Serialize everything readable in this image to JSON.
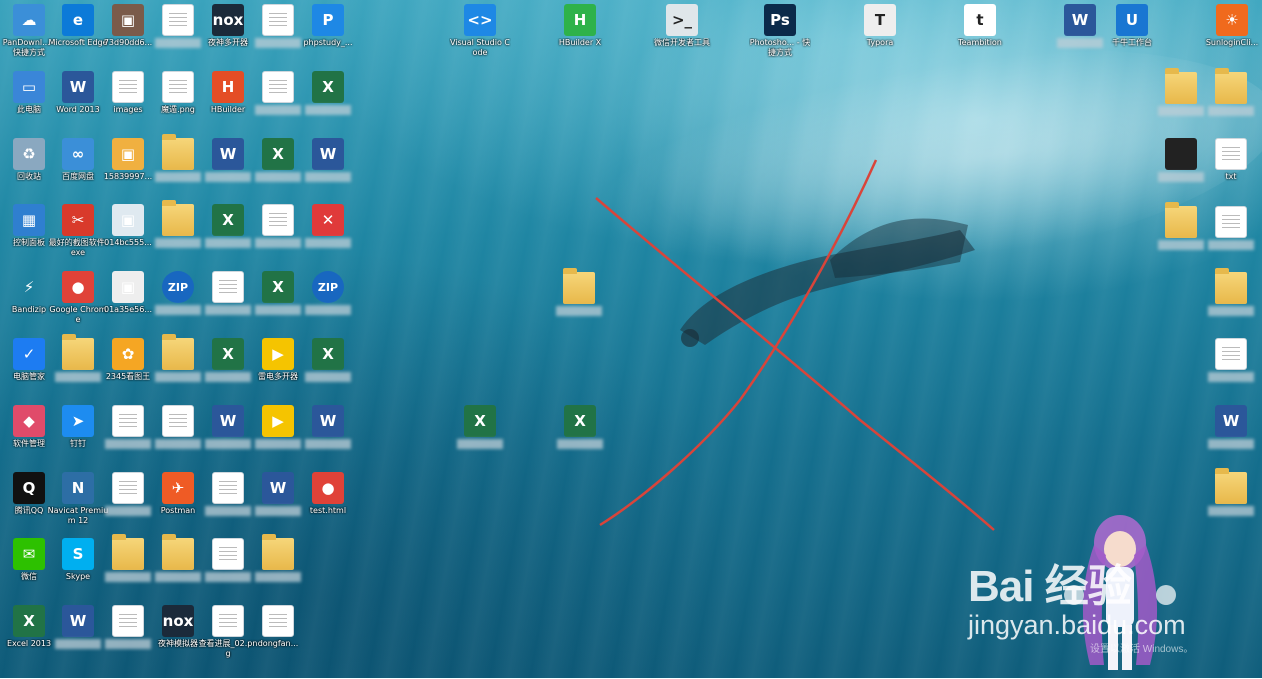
{
  "desktop": {
    "icons_col1": [
      {
        "label": "PanDownl... - 快捷方式",
        "icon": "cloud-icon",
        "color": "#3b8fd8"
      },
      {
        "label": "此电脑",
        "icon": "computer-icon",
        "color": "#3a86d8"
      },
      {
        "label": "回收站",
        "icon": "recycle-bin-icon",
        "color": "#8aa8c0"
      },
      {
        "label": "控制面板",
        "icon": "control-panel-icon",
        "color": "#2f7fd0"
      },
      {
        "label": "Bandizip",
        "icon": "bandizip-icon",
        "color": "#1867c0"
      },
      {
        "label": "电脑管家",
        "icon": "shield-icon",
        "color": "#1d7cf2"
      },
      {
        "label": "软件管理",
        "icon": "apps-icon",
        "color": "#e04b6a"
      },
      {
        "label": "腾讯QQ",
        "icon": "qq-icon",
        "color": "#111111"
      },
      {
        "label": "微信",
        "icon": "wechat-icon",
        "color": "#2dc100"
      },
      {
        "label": "Excel 2013",
        "icon": "excel-icon",
        "color": "#217346"
      }
    ],
    "icons_col2": [
      {
        "label": "Microsoft Edge",
        "icon": "edge-icon",
        "color": "#0c7ad8"
      },
      {
        "label": "Word 2013",
        "icon": "word-icon",
        "color": "#2b579a"
      },
      {
        "label": "百度网盘",
        "icon": "baidu-netdisk-icon",
        "color": "#3b8fd8"
      },
      {
        "label": "最好的截图软件.exe",
        "icon": "snip-icon",
        "color": "#d93a2b"
      },
      {
        "label": "Google Chrome",
        "icon": "chrome-icon",
        "color": "#e04238"
      },
      {
        "label": "",
        "icon": "folder-icon",
        "color": "#e8b84a"
      },
      {
        "label": "钉钉",
        "icon": "dingtalk-icon",
        "color": "#1d8cf0"
      },
      {
        "label": "Navicat Premium 12",
        "icon": "navicat-icon",
        "color": "#2d6ea5"
      },
      {
        "label": "Skype",
        "icon": "skype-icon",
        "color": "#00aff0"
      },
      {
        "label": "",
        "icon": "word-icon",
        "color": "#2b579a"
      }
    ],
    "icons_col3": [
      {
        "label": "73d90dd6...",
        "icon": "image-icon",
        "color": "#7a5b4a"
      },
      {
        "label": "images",
        "icon": "doc-icon",
        "color": "#ffffff"
      },
      {
        "label": "15839997...",
        "icon": "image-icon",
        "color": "#f0b040"
      },
      {
        "label": "014bc555...",
        "icon": "image-icon",
        "color": "#dfe9f0"
      },
      {
        "label": "01a35e56...",
        "icon": "image-icon",
        "color": "#eeeeee"
      },
      {
        "label": "2345看图王",
        "icon": "image-viewer-icon",
        "color": "#f5a623"
      },
      {
        "label": "",
        "icon": "doc-icon",
        "color": "#ffffff"
      },
      {
        "label": "",
        "icon": "doc-icon",
        "color": "#ffffff"
      },
      {
        "label": "",
        "icon": "folder-icon",
        "color": "#e8b84a"
      },
      {
        "label": "",
        "icon": "doc-icon",
        "color": "#ffffff"
      }
    ],
    "icons_col4": [
      {
        "label": "",
        "icon": "doc-icon",
        "color": "#ffffff"
      },
      {
        "label": "魔遁.png",
        "icon": "doc-icon",
        "color": "#ffffff"
      },
      {
        "label": "",
        "icon": "folder-icon",
        "color": "#e8b84a"
      },
      {
        "label": "",
        "icon": "folder-icon",
        "color": "#e8b84a"
      },
      {
        "label": "",
        "icon": "zip-icon",
        "color": "#1867c0"
      },
      {
        "label": "",
        "icon": "folder-icon",
        "color": "#e8b84a"
      },
      {
        "label": "",
        "icon": "doc-icon",
        "color": "#ffffff"
      },
      {
        "label": "Postman",
        "icon": "postman-icon",
        "color": "#ef5b25"
      },
      {
        "label": "",
        "icon": "folder-icon",
        "color": "#e8b84a"
      },
      {
        "label": "夜神模拟器",
        "icon": "nox-icon",
        "color": "#1b2a3a"
      }
    ],
    "icons_col5": [
      {
        "label": "夜神多开器",
        "icon": "nox-icon",
        "color": "#1b2a3a"
      },
      {
        "label": "HBuilder",
        "icon": "hbuilder-icon",
        "color": "#e44d26"
      },
      {
        "label": "",
        "icon": "word-icon",
        "color": "#2b579a"
      },
      {
        "label": "",
        "icon": "excel-doc-icon",
        "color": "#217346"
      },
      {
        "label": "",
        "icon": "doc-icon",
        "color": "#ffffff"
      },
      {
        "label": "",
        "icon": "excel-doc-icon",
        "color": "#217346"
      },
      {
        "label": "",
        "icon": "word-icon",
        "color": "#2b579a"
      },
      {
        "label": "",
        "icon": "doc-icon",
        "color": "#ffffff"
      },
      {
        "label": "",
        "icon": "doc-icon",
        "color": "#ffffff"
      },
      {
        "label": "查看进展_02.png",
        "icon": "doc-icon",
        "color": "#ffffff"
      }
    ],
    "icons_col6": [
      {
        "label": "",
        "icon": "doc-icon",
        "color": "#ffffff"
      },
      {
        "label": "",
        "icon": "doc-icon",
        "color": "#ffffff"
      },
      {
        "label": "",
        "icon": "excel-doc-icon",
        "color": "#217346"
      },
      {
        "label": "",
        "icon": "doc-icon",
        "color": "#ffffff"
      },
      {
        "label": "",
        "icon": "excel-doc-icon",
        "color": "#217346"
      },
      {
        "label": "雷电多开器",
        "icon": "ldplayer-icon",
        "color": "#f5c400"
      },
      {
        "label": "",
        "icon": "ldplayer-icon",
        "color": "#f5c400"
      },
      {
        "label": "",
        "icon": "word-icon",
        "color": "#2b579a"
      },
      {
        "label": "",
        "icon": "folder-icon",
        "color": "#e8b84a"
      },
      {
        "label": "dongfan...",
        "icon": "doc-icon",
        "color": "#ffffff"
      }
    ],
    "icons_col7": [
      {
        "label": "phpstudy_...",
        "icon": "phpstudy-icon",
        "color": "#1e88e5"
      },
      {
        "label": "",
        "icon": "excel-doc-icon",
        "color": "#217346"
      },
      {
        "label": "",
        "icon": "word-icon",
        "color": "#2b579a"
      },
      {
        "label": "",
        "icon": "xmind-icon",
        "color": "#e03a3a"
      },
      {
        "label": "",
        "icon": "zip-icon",
        "color": "#1867c0"
      },
      {
        "label": "",
        "icon": "excel-doc-icon",
        "color": "#217346"
      },
      {
        "label": "",
        "icon": "word-icon",
        "color": "#2b579a"
      },
      {
        "label": "test.html",
        "icon": "chrome-icon",
        "color": "#e04238"
      }
    ],
    "icons_top": [
      {
        "label": "Visual Studio Code",
        "icon": "vscode-icon",
        "color": "#1e88e5"
      },
      {
        "label": "HBuilder X",
        "icon": "hbuilderx-icon",
        "color": "#2eb24a"
      },
      {
        "label": "微信开发者工具",
        "icon": "wechat-devtools-icon",
        "color": "#dfe6ea"
      },
      {
        "label": "Photosho... - 快捷方式",
        "icon": "photoshop-icon",
        "color": "#0b2a4a"
      },
      {
        "label": "Typora",
        "icon": "typora-icon",
        "color": "#eeeeee"
      },
      {
        "label": "Teambition",
        "icon": "teambition-icon",
        "color": "#ffffff"
      },
      {
        "label": "",
        "icon": "word-icon",
        "color": "#2b579a"
      },
      {
        "label": "千牛工作台",
        "icon": "qianniu-icon",
        "color": "#1976d2"
      },
      {
        "label": "SunloginCli...",
        "icon": "sunlogin-icon",
        "color": "#f06a1d"
      }
    ],
    "icons_middle": [
      {
        "label": "",
        "icon": "folder-icon",
        "color": "#e8b84a"
      },
      {
        "label": "",
        "icon": "excel-doc-icon",
        "color": "#217346"
      },
      {
        "label": "",
        "icon": "excel-doc-icon",
        "color": "#217346"
      }
    ],
    "icons_right": [
      {
        "label": "",
        "icon": "folder-icon",
        "color": "#e8b84a"
      },
      {
        "label": "",
        "icon": "folder-icon",
        "color": "#e8b84a"
      },
      {
        "label": "",
        "icon": "dark-file-icon",
        "color": "#222222"
      },
      {
        "label": "txt",
        "icon": "doc-icon",
        "color": "#ffffff"
      },
      {
        "label": "",
        "icon": "folder-icon",
        "color": "#e8b84a"
      },
      {
        "label": "",
        "icon": "doc-icon",
        "color": "#ffffff"
      },
      {
        "label": "",
        "icon": "folder-icon",
        "color": "#e8b84a"
      },
      {
        "label": "",
        "icon": "doc-icon",
        "color": "#ffffff"
      },
      {
        "label": "",
        "icon": "word-icon",
        "color": "#2b579a"
      },
      {
        "label": "",
        "icon": "folder-icon",
        "color": "#e8b84a"
      }
    ]
  },
  "watermark": {
    "logo": "Bai  经验",
    "site": "jingyan.baidu.com",
    "activate": "设置以激活 Windows。"
  },
  "annotation": {
    "color": "#d9443a"
  }
}
